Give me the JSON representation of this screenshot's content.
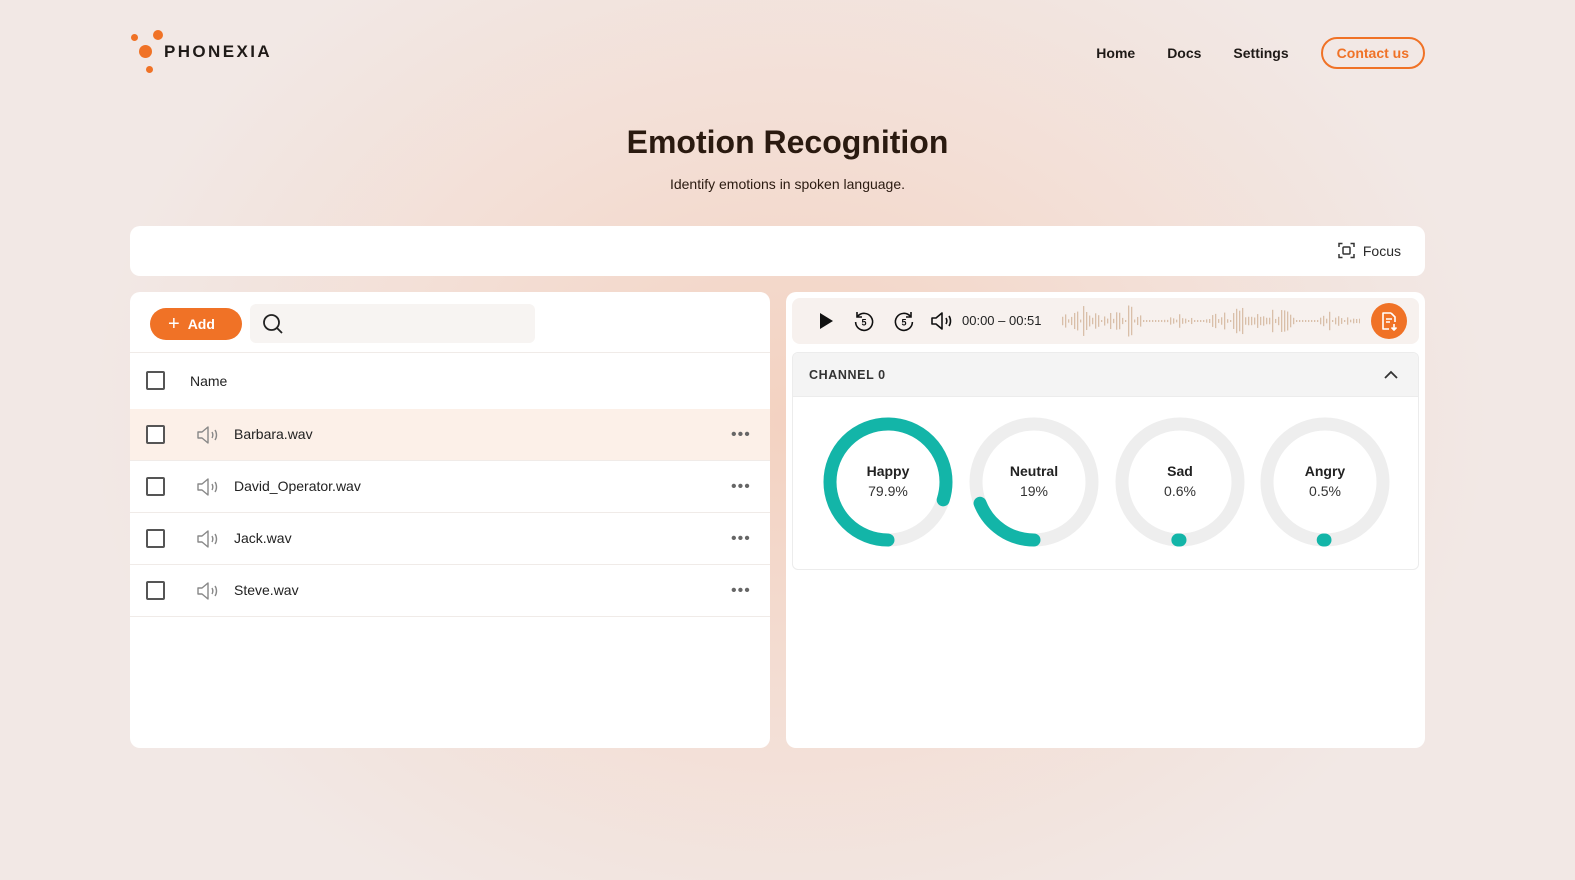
{
  "brand": {
    "name": "PHONEXIA"
  },
  "nav": {
    "home": "Home",
    "docs": "Docs",
    "settings": "Settings",
    "contact": "Contact us"
  },
  "page": {
    "title": "Emotion Recognition",
    "subtitle": "Identify emotions in spoken language."
  },
  "toolbar": {
    "focus_label": "Focus"
  },
  "files": {
    "add_label": "Add",
    "search_placeholder": "",
    "column_name": "Name",
    "items": [
      {
        "name": "Barbara.wav",
        "selected": true
      },
      {
        "name": "David_Operator.wav",
        "selected": false
      },
      {
        "name": "Jack.wav",
        "selected": false
      },
      {
        "name": "Steve.wav",
        "selected": false
      }
    ]
  },
  "player": {
    "time_range": "00:00 – 00:51"
  },
  "channel": {
    "label": "CHANNEL 0",
    "emotions": [
      {
        "name": "Happy",
        "value_text": "79.9%",
        "value": 79.9
      },
      {
        "name": "Neutral",
        "value_text": "19%",
        "value": 19
      },
      {
        "name": "Sad",
        "value_text": "0.6%",
        "value": 0.6
      },
      {
        "name": "Angry",
        "value_text": "0.5%",
        "value": 0.5
      }
    ]
  },
  "colors": {
    "accent": "#f07226",
    "gauge_fill": "#13b5a8",
    "gauge_track": "#eeeeee",
    "selected_row": "#fcf0e8"
  }
}
